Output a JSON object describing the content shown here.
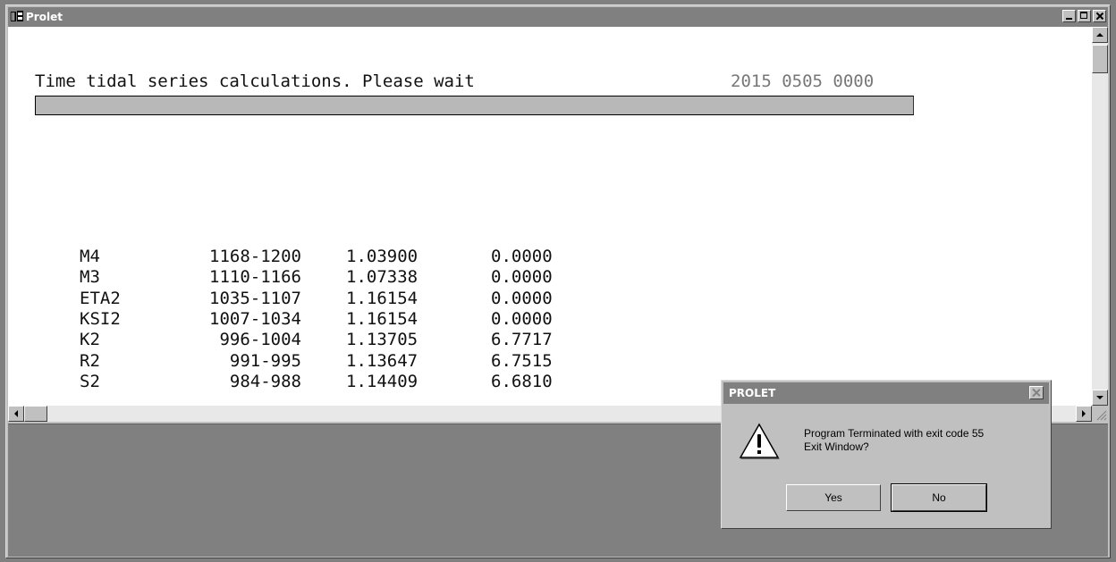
{
  "window": {
    "title": "Prolet"
  },
  "console": {
    "status_text": "Time tidal series calculations. Please wait",
    "timestamp": "2015 0505 0000",
    "progress_percent": 100
  },
  "table": {
    "rows": [
      {
        "name": "M4",
        "range": "1168-1200",
        "factor": "1.03900",
        "value": "0.0000"
      },
      {
        "name": "M3",
        "range": "1110-1166",
        "factor": "1.07338",
        "value": "0.0000"
      },
      {
        "name": "ETA2",
        "range": "1035-1107",
        "factor": "1.16154",
        "value": "0.0000"
      },
      {
        "name": "KSI2",
        "range": "1007-1034",
        "factor": "1.16154",
        "value": "0.0000"
      },
      {
        "name": "K2",
        "range": "996-1004",
        "factor": "1.13705",
        "value": "6.7717"
      },
      {
        "name": "R2",
        "range": "991-995",
        "factor": "1.13647",
        "value": "6.7515"
      },
      {
        "name": "S2",
        "range": "984-988",
        "factor": "1.14409",
        "value": "6.6810"
      }
    ]
  },
  "dialog": {
    "title": "PROLET",
    "message_line1": "Program Terminated with exit code 55",
    "message_line2": "Exit Window?",
    "yes_label": "Yes",
    "no_label": "No",
    "icon": "warning-icon"
  }
}
